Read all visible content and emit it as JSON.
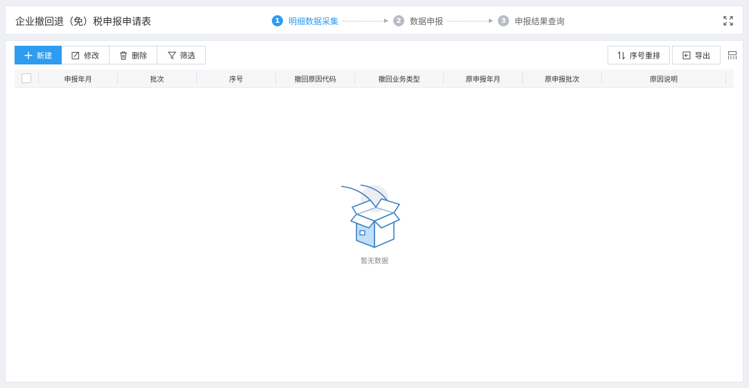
{
  "header": {
    "title": "企业撤回退（免）税申报申请表",
    "steps": [
      {
        "num": "1",
        "label": "明细数据采集",
        "active": true
      },
      {
        "num": "2",
        "label": "数据申报",
        "active": false
      },
      {
        "num": "3",
        "label": "申报结果查询",
        "active": false
      }
    ],
    "fullscreen_icon": "expand-icon"
  },
  "toolbar": {
    "new_label": "新建",
    "edit_label": "修改",
    "delete_label": "删除",
    "filter_label": "筛选",
    "reorder_label": "序号重排",
    "export_label": "导出",
    "columns_icon": "column-settings-icon"
  },
  "table": {
    "columns": [
      "申报年月",
      "批次",
      "序号",
      "撤回原因代码",
      "撤回业务类型",
      "原申报年月",
      "原申报批次",
      "原因说明"
    ],
    "rows": []
  },
  "empty_state": {
    "text": "暂无数据",
    "icon": "empty-box-icon"
  },
  "colors": {
    "accent": "#2e9cf0",
    "background": "#eef0f4"
  }
}
